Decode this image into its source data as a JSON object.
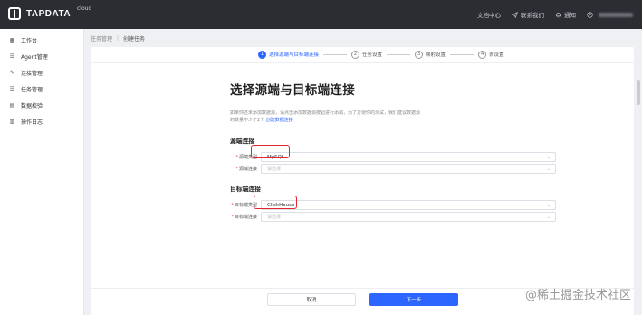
{
  "topbar": {
    "brand": "TAPDATA",
    "brand_sup": "cloud",
    "docs": "文档中心",
    "contact": "联系我们",
    "notify": "通知"
  },
  "sidebar": {
    "items": [
      {
        "label": "工作台",
        "icon": "dashboard-icon"
      },
      {
        "label": "Agent管理",
        "icon": "agent-icon"
      },
      {
        "label": "连接管理",
        "icon": "connection-icon"
      },
      {
        "label": "任务管理",
        "icon": "task-icon"
      },
      {
        "label": "数据校验",
        "icon": "verify-icon"
      },
      {
        "label": "操作日志",
        "icon": "log-icon"
      }
    ]
  },
  "breadcrumb": {
    "parent": "任务管理",
    "current": "创建任务"
  },
  "steps": [
    {
      "num": "1",
      "label": "选择源端与目标端连接"
    },
    {
      "num": "2",
      "label": "任务设置"
    },
    {
      "num": "3",
      "label": "映射设置"
    },
    {
      "num": "4",
      "label": "表设置"
    }
  ],
  "main": {
    "heading": "选择源端与目标端连接",
    "desc_line1": "如果你还未添加数据源，请点击添加数据源按钮进行添加，为了方便你的测试，我们建议数据源",
    "desc_line2": "的数量不少于2个",
    "desc_link": "创建数据连接",
    "source_title": "源端连接",
    "source_type_label": "源端类型",
    "source_type_value": "MySQL",
    "source_conn_label": "源端连接",
    "source_conn_placeholder": "请选择",
    "target_title": "目标端连接",
    "target_type_label": "目标端类型",
    "target_type_value": "ClickHouse",
    "target_conn_label": "目标端连接",
    "target_conn_placeholder": "请选择"
  },
  "footer": {
    "cancel": "取消",
    "next": "下一步"
  },
  "watermark": "@稀土掘金技术社区",
  "colors": {
    "accent": "#2c65ff",
    "highlight": "#e3262f",
    "topbar": "#2b2d33"
  }
}
